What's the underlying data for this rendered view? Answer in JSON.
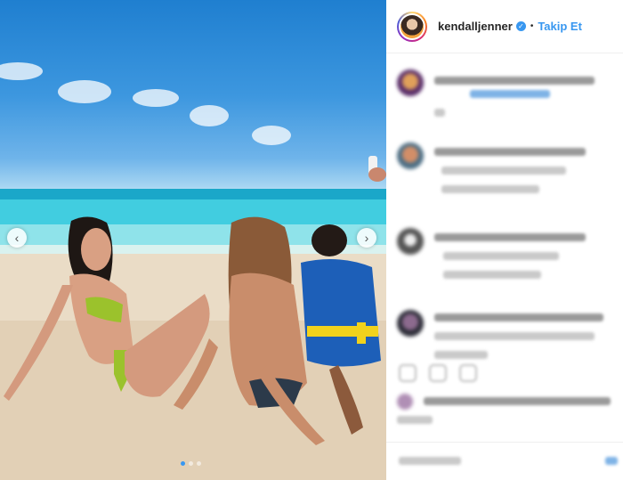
{
  "post": {
    "username": "kendalljenner",
    "separator": "•",
    "follow_label": "Takip Et",
    "verified_glyph": "✓"
  },
  "carousel": {
    "prev_glyph": "‹",
    "next_glyph": "›",
    "slide_count": 3,
    "active_slide": 1
  },
  "icons": {
    "prev": "chevron-left-icon",
    "next": "chevron-right-icon",
    "verified": "verified-badge-icon"
  },
  "colors": {
    "link_blue": "#3897f0",
    "text": "#262626",
    "border": "#efefef"
  }
}
